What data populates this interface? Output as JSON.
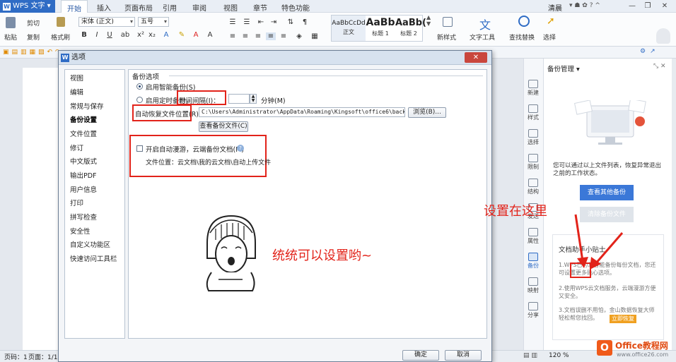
{
  "titlebar": {
    "app_name": "WPS 文字",
    "tabs": [
      "开始",
      "插入",
      "页面布局",
      "引用",
      "审阅",
      "视图",
      "章节",
      "特色功能"
    ],
    "user": "清晨",
    "controls": [
      "—",
      "❐",
      "✕"
    ]
  },
  "ribbon": {
    "paste": "粘贴",
    "cut": "剪切",
    "copy": "复制",
    "format_painter": "格式刷",
    "font_name": "宋体 (正文)",
    "font_size": "五号",
    "styles": [
      {
        "sample": "AaBbCcDd",
        "name": "正文"
      },
      {
        "sample": "AaBb",
        "name": "标题 1"
      },
      {
        "sample": "AaBb(",
        "name": "标题 2"
      }
    ],
    "new_style": "新样式",
    "text_tools": "文字工具",
    "find_replace": "查找替换",
    "select": "选择"
  },
  "dialog": {
    "title": "选项",
    "nav": [
      "视图",
      "编辑",
      "常规与保存",
      "备份设置",
      "文件位置",
      "修订",
      "中文版式",
      "输出PDF",
      "用户信息",
      "打印",
      "拼写检查",
      "安全性",
      "自定义功能区",
      "快速访问工具栏"
    ],
    "selected_nav": "备份设置",
    "group_title": "备份选项",
    "smart_backup": "启用智能备份(S)",
    "timed_backup": "启用定时备份，",
    "interval_label": "时间间隔(I)：",
    "interval_value": "",
    "minutes": "分钟(M)",
    "autorecover_label": "自动恢复文件位置(R)：",
    "autorecover_path": "C:\\Users\\Administrator\\AppData\\Roaming\\Kingsoft\\office6\\backup",
    "browse": "浏览(B)...",
    "view_backup": "查看备份文件(C)",
    "roaming_label": "开启自动漫游，云端备份文档(M)",
    "file_location": "文件位置：云文档\\我的云文档\\自动上传文件",
    "ok": "确定",
    "cancel": "取消"
  },
  "side_rail": [
    "新建",
    "样式",
    "选择",
    "限制",
    "结构",
    "发送",
    "属性",
    "备份",
    "映射",
    "分享"
  ],
  "side_panel": {
    "title": "备份管理",
    "info": "您可以通过以上文件列表，恢复异常退出之前的工作状态。",
    "view_other": "查看其他备份",
    "clear_backup": "清除备份文件",
    "tips_title": "文档助手小贴士",
    "tip1": "1.WPS已为您智能备份每份文档，您还可设置更多贴心选项。",
    "tip2": "2.使用WPS云文档服务，云端漫游方便又安全。",
    "tip3": "3.文档误删不用怕，金山数据恢复大师轻松帮您找回。",
    "restore_now": "立即恢复"
  },
  "annotations": {
    "here": "设置在这里",
    "all": "统统可以设置哟~"
  },
  "statusbar": {
    "page": "页码：1",
    "pages": "页面：1/1",
    "zoom": "120 %"
  },
  "watermark": {
    "brand": "Office教程网",
    "url": "www.office26.com"
  },
  "colors": {
    "accent": "#2f6cc5",
    "annotation": "#e2231a",
    "dialog_bg": "#f3f5f8"
  }
}
